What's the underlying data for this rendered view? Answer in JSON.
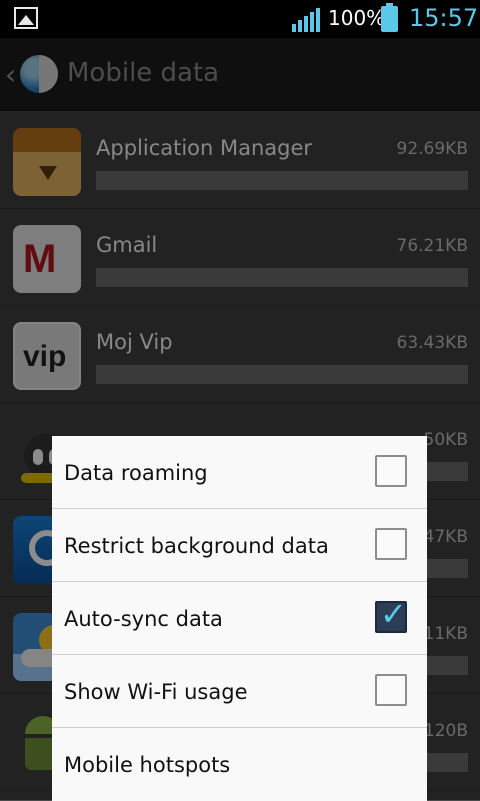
{
  "status_bar": {
    "battery_percent": "100%",
    "time": "15:57",
    "icons": [
      "gallery-icon",
      "signal-icon",
      "battery-icon"
    ],
    "accent_color": "#5bc8ea"
  },
  "title_bar": {
    "title": "Mobile data",
    "back_icon": "chevron-left-icon",
    "app_icon": "mobile-data-pie-icon"
  },
  "apps": [
    {
      "name": "Application Manager",
      "size": "92.69KB",
      "icon": "app-manager-icon"
    },
    {
      "name": "Gmail",
      "size": "76.21KB",
      "icon": "gmail-icon"
    },
    {
      "name": "Moj Vip",
      "size": "63.43KB",
      "icon": "vip-icon"
    },
    {
      "name": "",
      "size": "50KB",
      "icon": "bomb-icon"
    },
    {
      "name": "",
      "size": "47KB",
      "icon": "shazam-icon"
    },
    {
      "name": "",
      "size": "11KB",
      "icon": "weather-icon"
    },
    {
      "name": "",
      "size": "120B",
      "icon": "android-icon"
    }
  ],
  "menu": {
    "items": [
      {
        "label": "Data roaming",
        "checkbox": true,
        "checked": false
      },
      {
        "label": "Restrict background data",
        "checkbox": true,
        "checked": false
      },
      {
        "label": "Auto-sync data",
        "checkbox": true,
        "checked": true
      },
      {
        "label": "Show Wi-Fi usage",
        "checkbox": true,
        "checked": false
      },
      {
        "label": "Mobile hotspots",
        "checkbox": false,
        "checked": false
      }
    ]
  }
}
